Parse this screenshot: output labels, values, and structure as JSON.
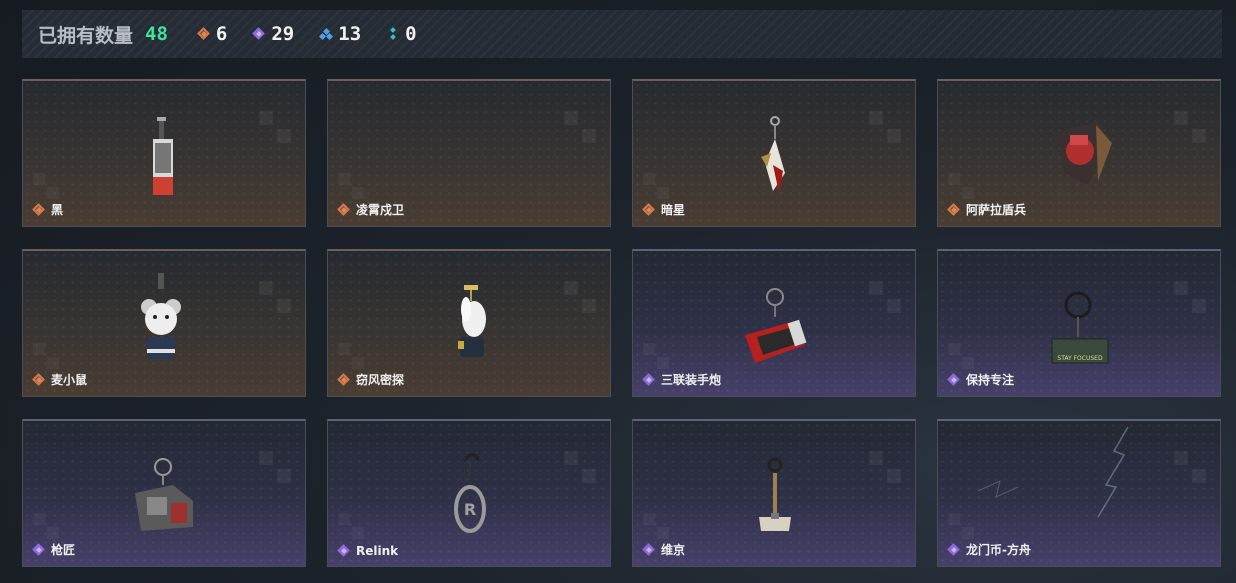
{
  "header": {
    "owned_label": "已拥有数量",
    "owned_count": "48",
    "stats": [
      {
        "icon": "orange-diamond-icon",
        "value": "6"
      },
      {
        "icon": "purple-diamond-icon",
        "value": "29"
      },
      {
        "icon": "blue-triple-diamond-icon",
        "value": "13"
      },
      {
        "icon": "teal-dot-icon",
        "value": "0"
      }
    ]
  },
  "colors": {
    "owned_count": "#3fe0a0",
    "orange_rarity": "#d47a4a",
    "purple_rarity": "#8e6ad8"
  },
  "cards": [
    {
      "name": "黑",
      "rarity": "orange"
    },
    {
      "name": "凌霄戍卫",
      "rarity": "orange"
    },
    {
      "name": "暗星",
      "rarity": "orange"
    },
    {
      "name": "阿萨拉盾兵",
      "rarity": "orange"
    },
    {
      "name": "麦小鼠",
      "rarity": "orange"
    },
    {
      "name": "窃风密探",
      "rarity": "orange"
    },
    {
      "name": "三联装手炮",
      "rarity": "purple"
    },
    {
      "name": "保持专注",
      "rarity": "purple"
    },
    {
      "name": "枪匠",
      "rarity": "purple"
    },
    {
      "name": "Relink",
      "rarity": "purple"
    },
    {
      "name": "维京",
      "rarity": "purple"
    },
    {
      "name": "龙门币-方舟",
      "rarity": "purple"
    }
  ],
  "pendant_texts": {
    "stay_focused": "STAY FOCUSED"
  }
}
